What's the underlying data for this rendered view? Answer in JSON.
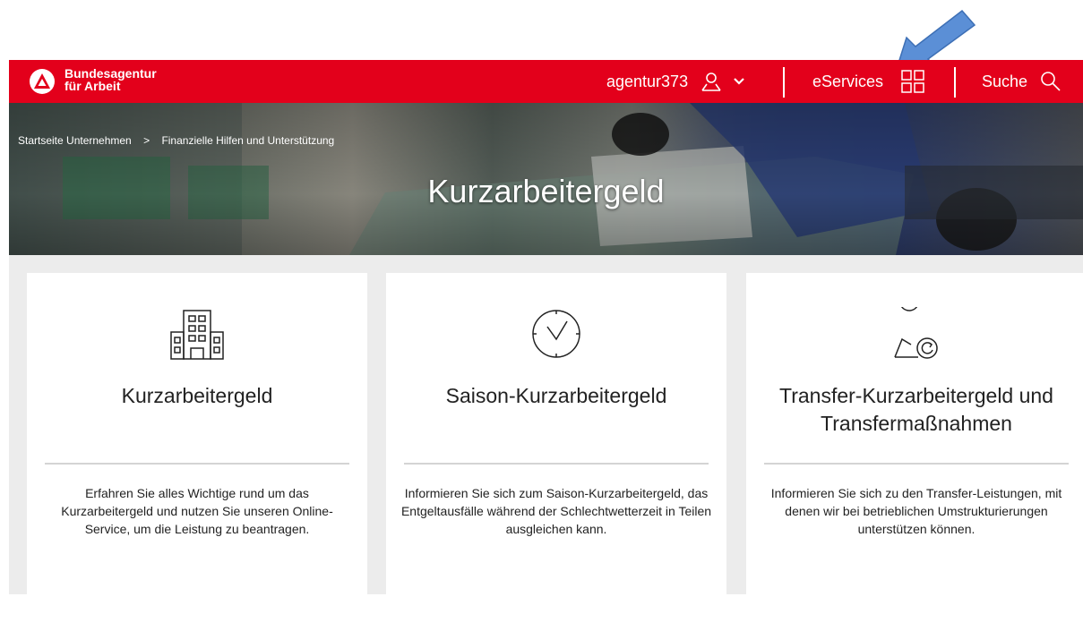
{
  "header": {
    "brand_line1": "Bundesagentur",
    "brand_line2": "für Arbeit",
    "user_name": "agentur373",
    "eservices_label": "eServices",
    "search_label": "Suche",
    "color": "#e3001b"
  },
  "breadcrumb": {
    "items": [
      "Startseite Unternehmen",
      "Finanzielle Hilfen und Unterstützung"
    ],
    "separator": ">"
  },
  "hero": {
    "title": "Kurzarbeitergeld"
  },
  "cards": [
    {
      "icon": "building-icon",
      "title": "Kurzarbeitergeld",
      "text": "Erfahren Sie alles Wichtige rund um das Kurzarbeitergeld und nutzen Sie unseren Online-Service, um die Leistung zu beantragen."
    },
    {
      "icon": "clock-icon",
      "title": "Saison-Kurzarbeitergeld",
      "text": "Informieren Sie sich zum Saison-Kurzarbeitergeld, das Entgeltausfälle während der Schlechtwetterzeit in Teilen ausgleichen kann."
    },
    {
      "icon": "person-transfer-icon",
      "title": "Transfer-Kurzarbeitergeld und Transfermaßnahmen",
      "text": "Informieren Sie sich zu den Transfer-Leistungen, mit denen wir bei betrieblichen Umstrukturierungen unterstützen können."
    }
  ],
  "annotation": {
    "icon": "arrow-icon",
    "color": "#5b8fd6"
  }
}
